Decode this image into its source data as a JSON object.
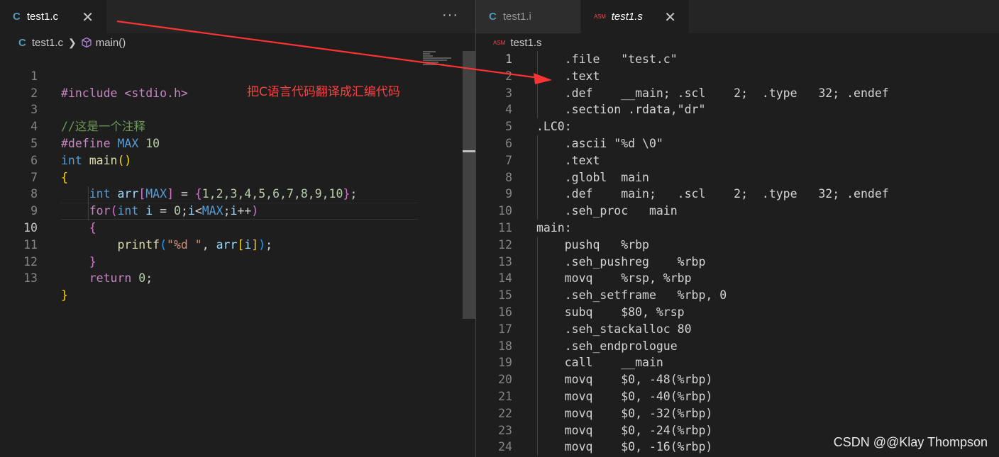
{
  "left_editor": {
    "tabs": [
      {
        "label": "test1.c",
        "icon": "C",
        "active": true
      }
    ],
    "more_actions": "···",
    "breadcrumb": {
      "icon": "C",
      "file": "test1.c",
      "symbol": "main()"
    },
    "current_line": 10
  },
  "right_editor": {
    "tabs": [
      {
        "label": "test1.i",
        "icon": "C",
        "active": false
      },
      {
        "label": "test1.s",
        "icon": "ASM",
        "active": true
      }
    ],
    "breadcrumb": {
      "icon": "ASM",
      "file": "test1.s"
    },
    "current_line": 1
  },
  "close_glyph": "✕",
  "annotation_text": "把C语言代码翻译成汇编代码",
  "annotation_color": "#ff4040",
  "watermark": "CSDN @@Klay Thompson",
  "c_source": {
    "include": "#include <stdio.h>",
    "comment": "//这是一个注释",
    "define_kw": "#define",
    "define_name": "MAX",
    "define_value": "10",
    "int_kw": "int",
    "main_name": "main",
    "arr_name": "arr",
    "arr_values": "1,2,3,4,5,6,7,8,9,10",
    "for_kw": "for",
    "loop_var": "i",
    "zero": "0",
    "printf_fn": "printf",
    "format_str": "\"%d \"",
    "return_kw": "return"
  },
  "asm_lines": [
    "    .file   \"test.c\"",
    "    .text",
    "    .def    __main; .scl    2;  .type   32; .endef",
    "    .section .rdata,\"dr\"",
    ".LC0:",
    "    .ascii \"%d \\0\"",
    "    .text",
    "    .globl  main",
    "    .def    main;   .scl    2;  .type   32; .endef",
    "    .seh_proc   main",
    "main:",
    "    pushq   %rbp",
    "    .seh_pushreg    %rbp",
    "    movq    %rsp, %rbp",
    "    .seh_setframe   %rbp, 0",
    "    subq    $80, %rsp",
    "    .seh_stackalloc 80",
    "    .seh_endprologue",
    "    call    __main",
    "    movq    $0, -48(%rbp)",
    "    movq    $0, -40(%rbp)",
    "    movq    $0, -32(%rbp)",
    "    movq    $0, -24(%rbp)",
    "    movq    $0, -16(%rbp)"
  ]
}
